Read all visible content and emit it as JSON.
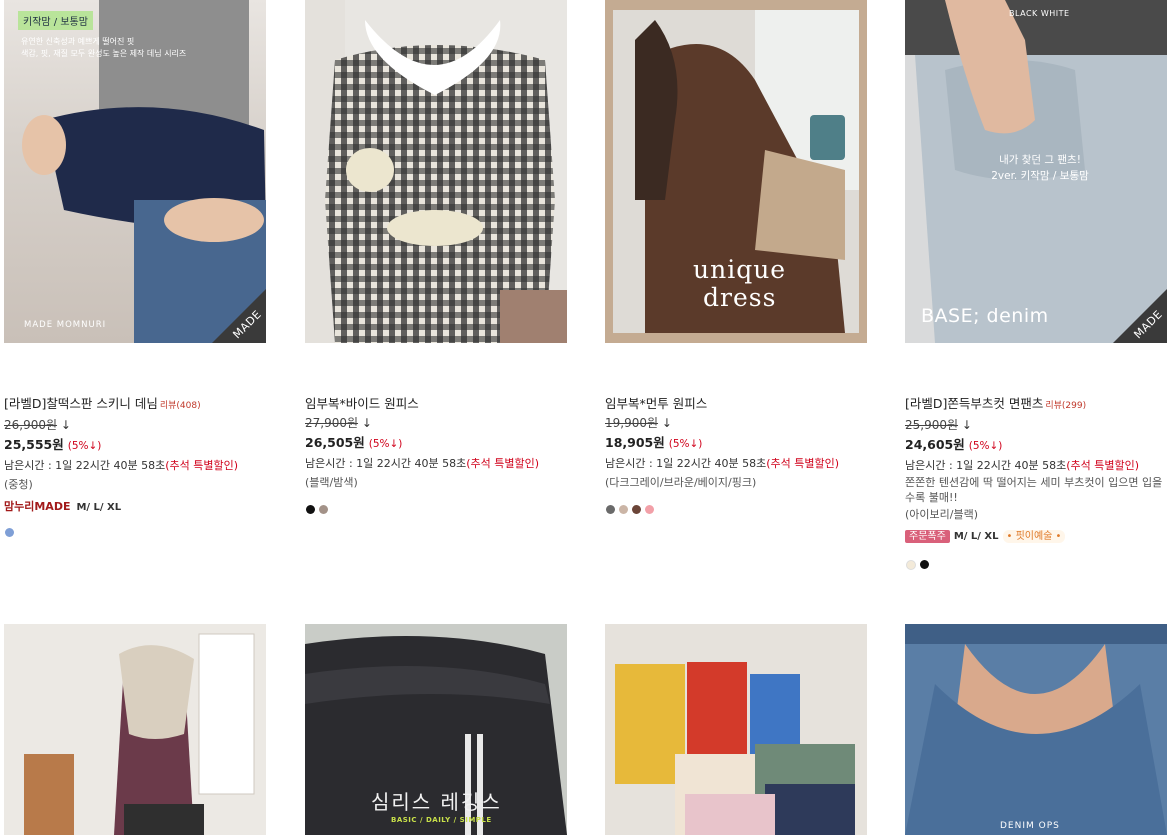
{
  "products": [
    {
      "name": "[라벨D]찰떡스판 스키니 데님",
      "review": "리뷰(408)",
      "old_price": "26,900원",
      "price": "25,555원",
      "discount": "(5%↓)",
      "timer": "남은시간 : 1일 22시간 40분 58초",
      "promo": "(추석 특별할인)",
      "colors": "(중청)",
      "tag_made": "맘누리MADE",
      "sizes": "M/ L/ XL",
      "image_tag": "키작맘 / 보통맘",
      "image_caption": "유연한 신축성과 예쁘게 떨어진 핏\n색감, 핏, 재질 모두 완성도 높은 제작 데님 시리즈",
      "image_brand": "MADE MOMNURI",
      "corner": "MADE",
      "swatches": [
        "#7f9fd6"
      ]
    },
    {
      "name": "임부복*바이드 원피스",
      "old_price": "27,900원",
      "price": "26,505원",
      "discount": "(5%↓)",
      "timer": "남은시간 : 1일 22시간 40분 58초",
      "promo": "(추석 특별할인)",
      "colors": "(블랙/밤색)",
      "swatches": [
        "#111111",
        "#a39288"
      ]
    },
    {
      "name": "임부복*먼투 원피스",
      "old_price": "19,900원",
      "price": "18,905원",
      "discount": "(5%↓)",
      "timer": "남은시간 : 1일 22시간 40분 58초",
      "promo": "(추석 특별할인)",
      "colors": "(다크그레이/브라운/베이지/핑크)",
      "image_title1": "unique",
      "image_title2": "dress",
      "swatches": [
        "#6a6a6a",
        "#cbb5a6",
        "#6b4538",
        "#f2a0a8"
      ]
    },
    {
      "name": "[라벨D]쫀득부츠컷 면팬츠",
      "review": "리뷰(299)",
      "old_price": "25,900원",
      "price": "24,605원",
      "discount": "(5%↓)",
      "timer": "남은시간 : 1일 22시간 40분 58초",
      "promo": "(추석 특별할인)",
      "desc": "쫀쫀한 텐션감에 딱 떨어지는 세미 부츠컷이 입으면 입을 수록 불매!!",
      "colors": "(아이보리/블랙)",
      "tag_order": "주문폭주",
      "sizes": "M/ L/ XL",
      "tag_pick": "• 핏이예술 •",
      "image_label": "BLACK WHITE",
      "image_caption": "내가 찾던 그 팬츠!\n2ver. 키작맘 / 보통맘",
      "image_brand": "BASE; denim",
      "corner": "MADE",
      "swatches": [
        "#f3ead9",
        "#111111"
      ]
    },
    {
      "image_title": ""
    },
    {
      "image_title": "심리스 레깅스",
      "image_sub": "BASIC / DAILY / SIMPLE"
    },
    {
      "image_title": ""
    },
    {
      "image_title": "DENIM OPS"
    }
  ]
}
